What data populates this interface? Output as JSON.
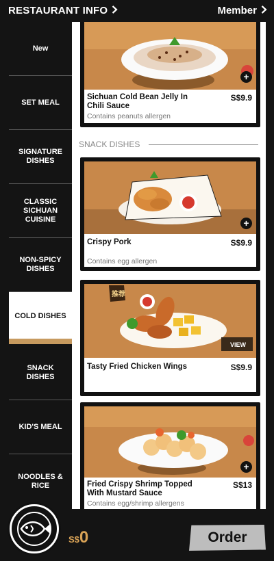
{
  "header": {
    "restaurant_info": "RESTAURANT INFO",
    "member": "Member"
  },
  "sidebar": {
    "items": [
      {
        "label": "New"
      },
      {
        "label": "SET MEAL"
      },
      {
        "label": "SIGNATURE DISHES"
      },
      {
        "label": "CLASSIC SICHUAN CUISINE"
      },
      {
        "label": "NON-SPICY DISHES"
      },
      {
        "label": "COLD DISHES",
        "active": true
      },
      {
        "label": "SNACK DISHES"
      },
      {
        "label": "KID'S MEAL"
      },
      {
        "label": "NOODLES & RICE"
      }
    ]
  },
  "menu": {
    "section_label": "SNACK DISHES",
    "items": [
      {
        "name": "Sichuan Cold Bean Jelly In Chili Sauce",
        "price": "S$9.9",
        "allergen": "Contains peanuts allergen"
      },
      {
        "name": "Crispy Pork",
        "price": "S$9.9",
        "allergen": "Contains egg allergen"
      },
      {
        "name": "Tasty Fried Chicken Wings",
        "price": "S$9.9",
        "allergen": "",
        "badge": "推荐",
        "view_label": "VIEW"
      },
      {
        "name": "Fried Crispy Shrimp Topped With Mustard Sauce",
        "price": "S$13",
        "allergen": "Contains egg/shrimp allergens"
      }
    ]
  },
  "footer": {
    "currency": "S$",
    "total": "0",
    "order_label": "Order"
  },
  "colors": {
    "background": "#141414",
    "accent": "#d8a256",
    "active_underline": "#c79a5f",
    "order_button": "#bdbdbd"
  }
}
